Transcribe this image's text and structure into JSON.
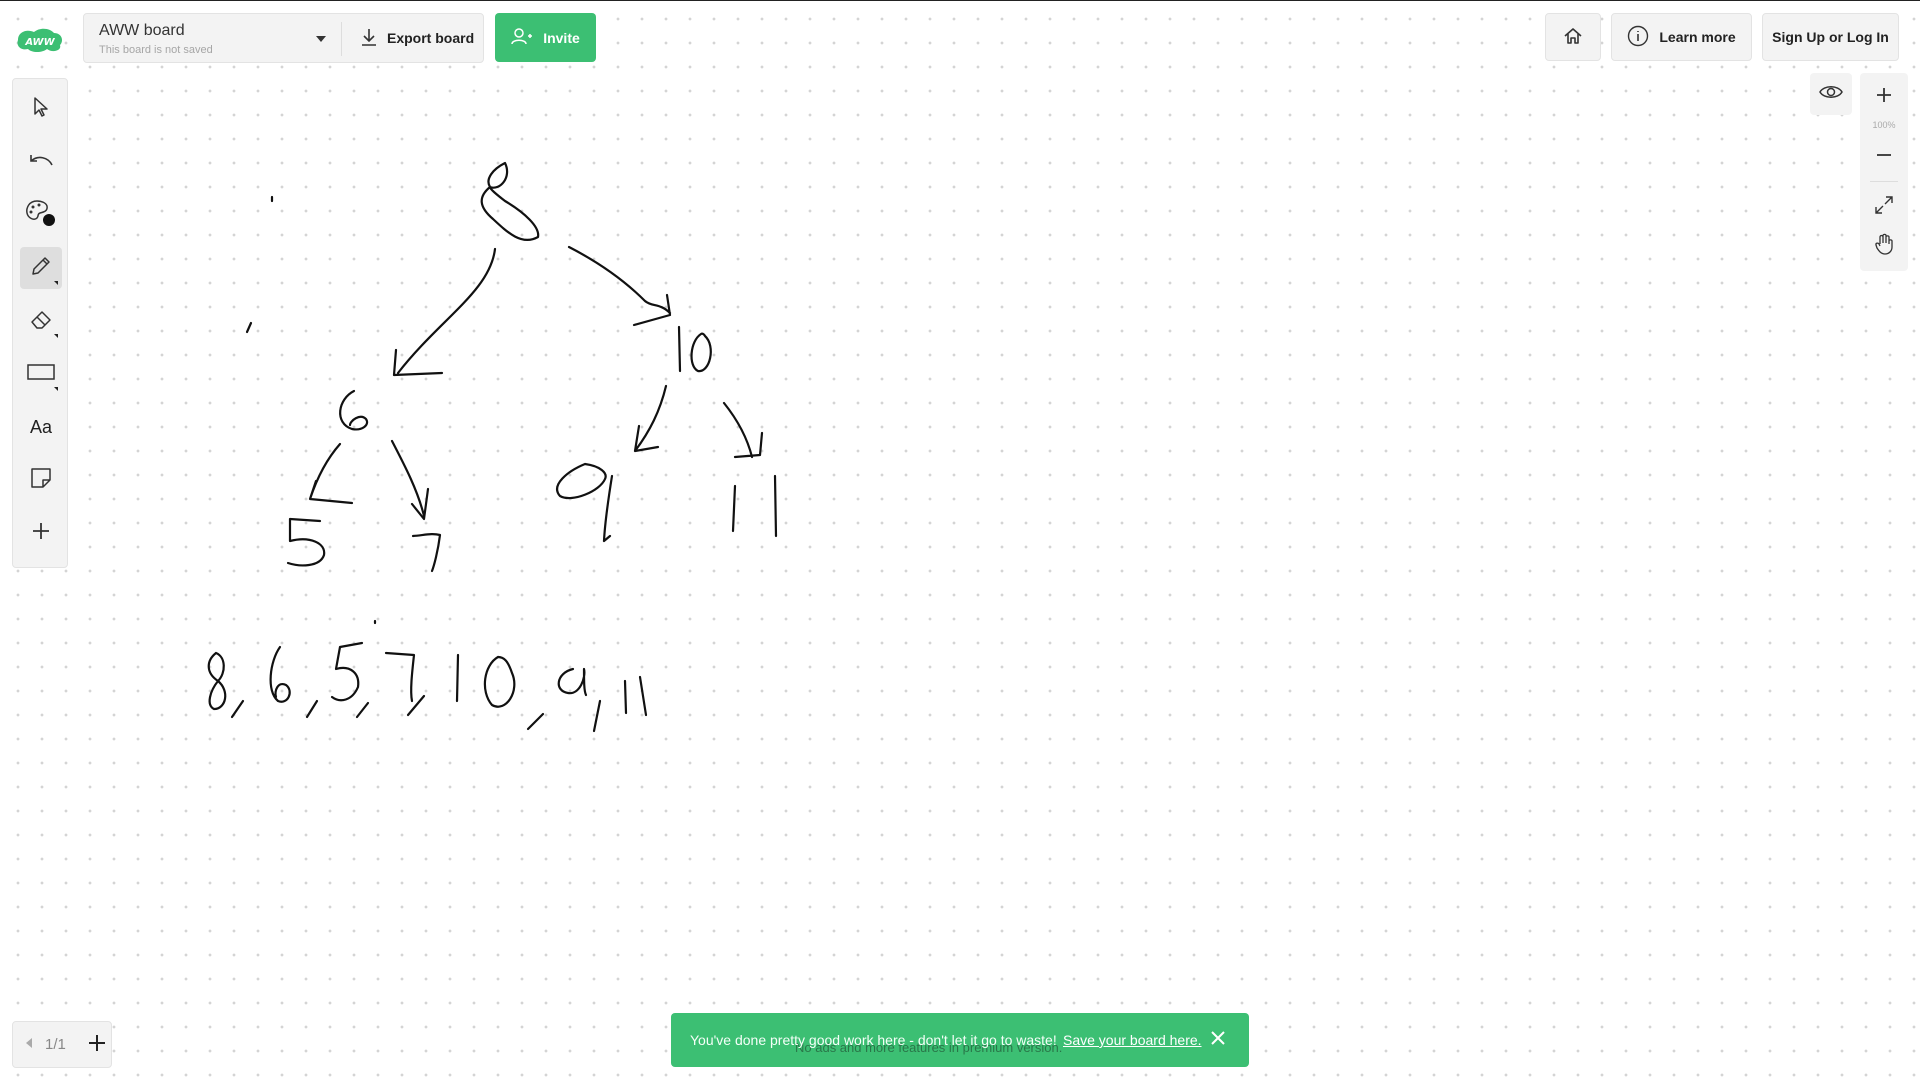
{
  "app": {
    "logo_text": "AWW"
  },
  "board": {
    "title": "AWW board",
    "subtitle": "This board is not saved",
    "export_label": "Export board",
    "invite_label": "Invite"
  },
  "header_right": {
    "learn_more_label": "Learn more",
    "signup_label": "Sign Up or Log In"
  },
  "toolbar": {
    "tools": [
      {
        "name": "select",
        "icon": "cursor-icon"
      },
      {
        "name": "undo",
        "icon": "undo-icon"
      },
      {
        "name": "color",
        "icon": "palette-icon"
      },
      {
        "name": "pen",
        "icon": "pencil-icon",
        "active": true
      },
      {
        "name": "eraser",
        "icon": "eraser-icon"
      },
      {
        "name": "shape",
        "icon": "rectangle-icon"
      },
      {
        "name": "text",
        "icon": "text-icon",
        "label": "Aa"
      },
      {
        "name": "sticky",
        "icon": "sticky-note-icon"
      },
      {
        "name": "add",
        "icon": "plus-icon"
      }
    ],
    "current_color": "#111111"
  },
  "zoom": {
    "level": "100%"
  },
  "pages": {
    "indicator": "1/1"
  },
  "toast": {
    "message": "You've done pretty good work here - don't let it go to waste!",
    "link": "Save your board here.",
    "sub": "No ads and more features in premium version."
  },
  "colors": {
    "accent": "#3cbf73",
    "panel_bg": "#f3f3f3",
    "ink": "#111111"
  }
}
